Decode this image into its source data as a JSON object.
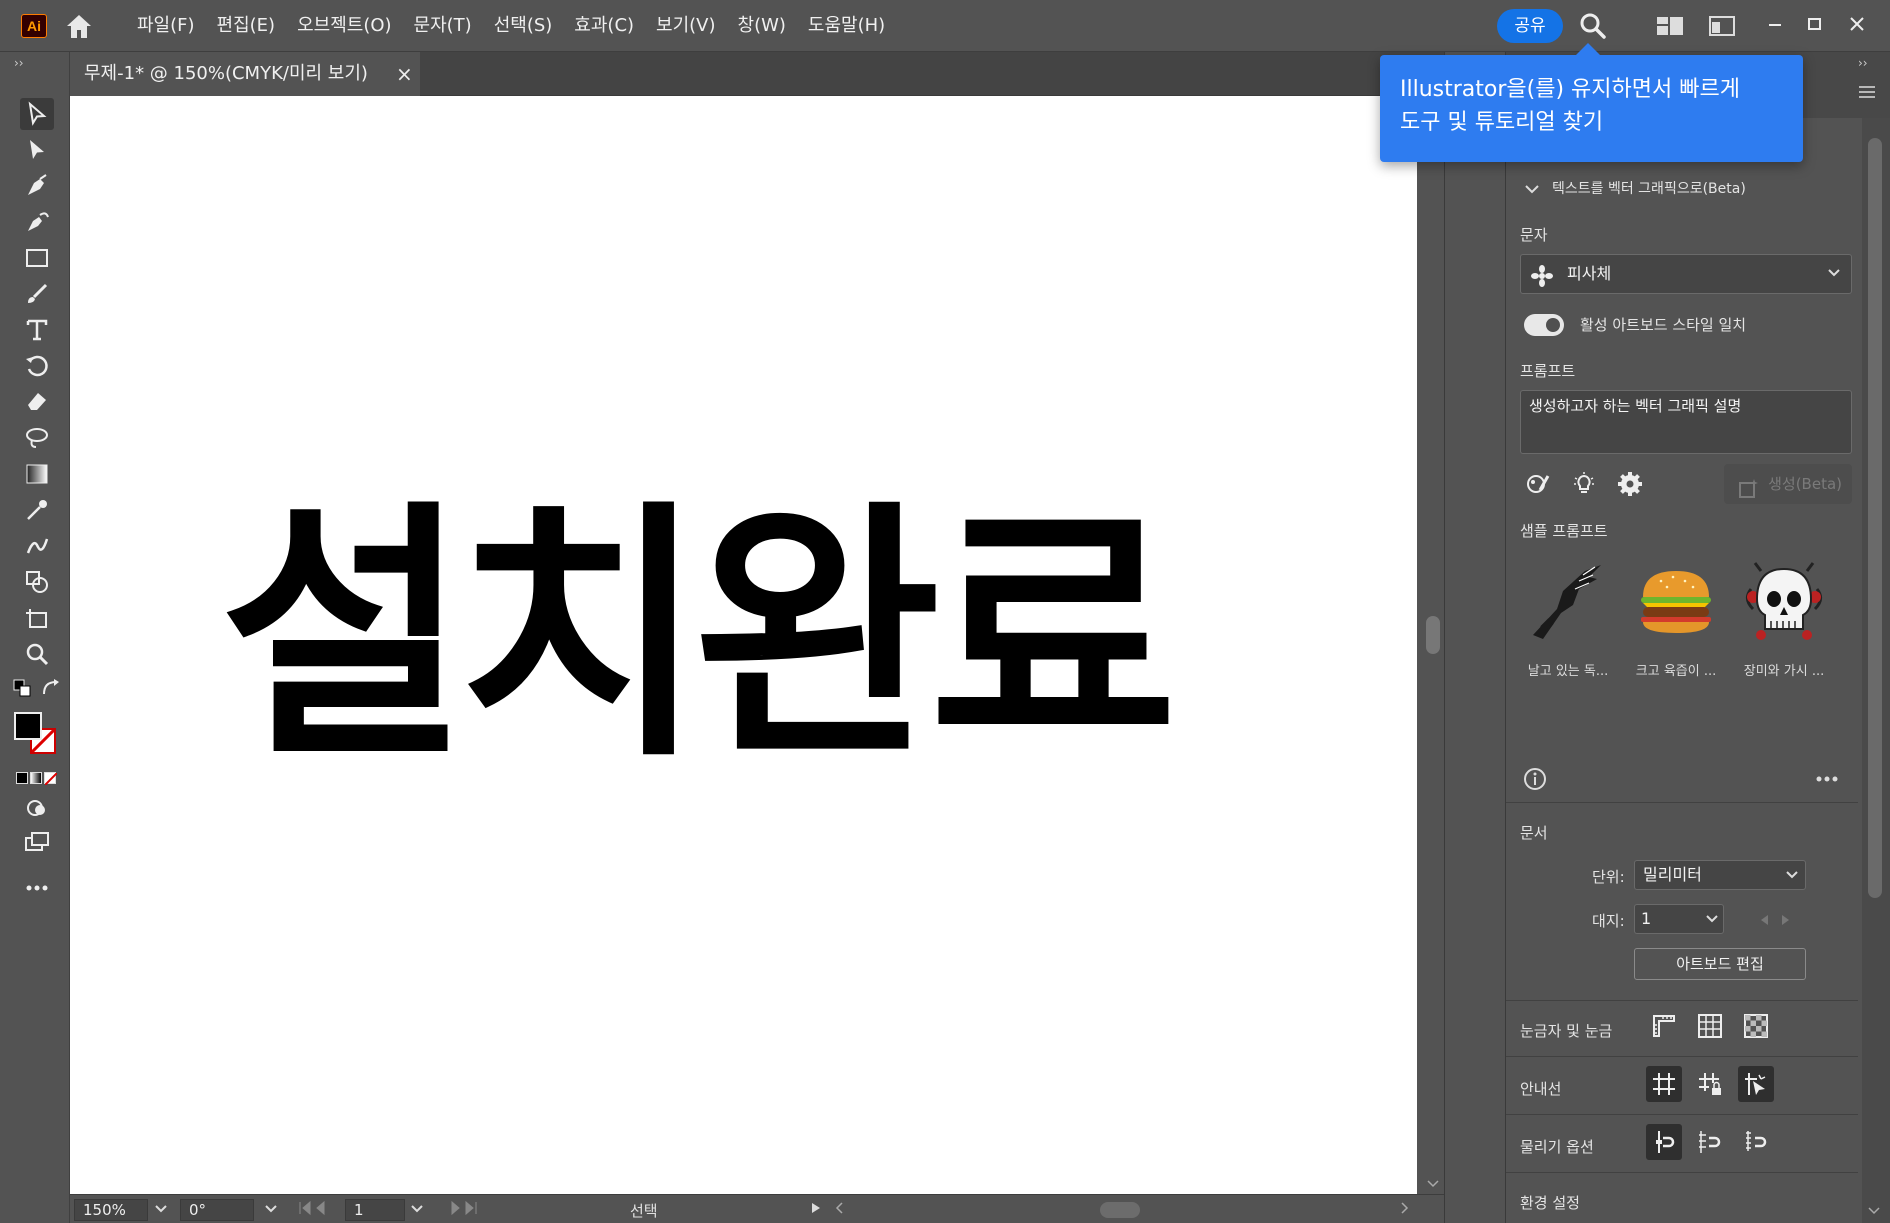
{
  "app": {
    "logo": "Ai",
    "brand_color": "#ff9a00"
  },
  "menu": {
    "items": [
      "파일(F)",
      "편집(E)",
      "오브젝트(O)",
      "문자(T)",
      "선택(S)",
      "효과(C)",
      "보기(V)",
      "창(W)",
      "도움말(H)"
    ]
  },
  "share_label": "공유",
  "tooltip": {
    "line1": "Illustrator을(를) 유지하면서 빠르게",
    "line2": "도구 및 튜토리얼 찾기"
  },
  "document": {
    "tab_title": "무제-1* @ 150%(CMYK/미리 보기)",
    "close_glyph": "×"
  },
  "artboard": {
    "text": "설치완료"
  },
  "status": {
    "zoom": "150%",
    "rotation": "0°",
    "artboard_index": "1",
    "mode": "선택"
  },
  "panel": {
    "section_title": "텍스트를 벡터 그래픽으로(Beta)",
    "content_label": "문자",
    "content_value": "피사체",
    "match_style_label": "활성 아트보드 스타일 일치",
    "match_style_on": true,
    "prompt_label": "프롬프트",
    "prompt_placeholder": "생성하고자 하는 벡터 그래픽 설명",
    "generate_label": "생성(Beta)",
    "samples_label": "샘플 프롬프트",
    "samples": [
      {
        "caption": "날고 있는 독..."
      },
      {
        "caption": "크고 육즙이 ..."
      },
      {
        "caption": "장미와 가시 ..."
      }
    ],
    "doc_section": "문서",
    "units_label": "단위:",
    "units_value": "밀리미터",
    "artboard_label": "대지:",
    "artboard_value": "1",
    "edit_artboard_btn": "아트보드 편집",
    "rulers_label": "눈금자 및 눈금",
    "guides_label": "안내선",
    "snap_label": "물리기 옵션",
    "prefs_label": "환경 설정"
  },
  "colors": {
    "accent": "#1473e6",
    "tooltip": "#2e7cf0",
    "ui_bg": "#535353"
  }
}
